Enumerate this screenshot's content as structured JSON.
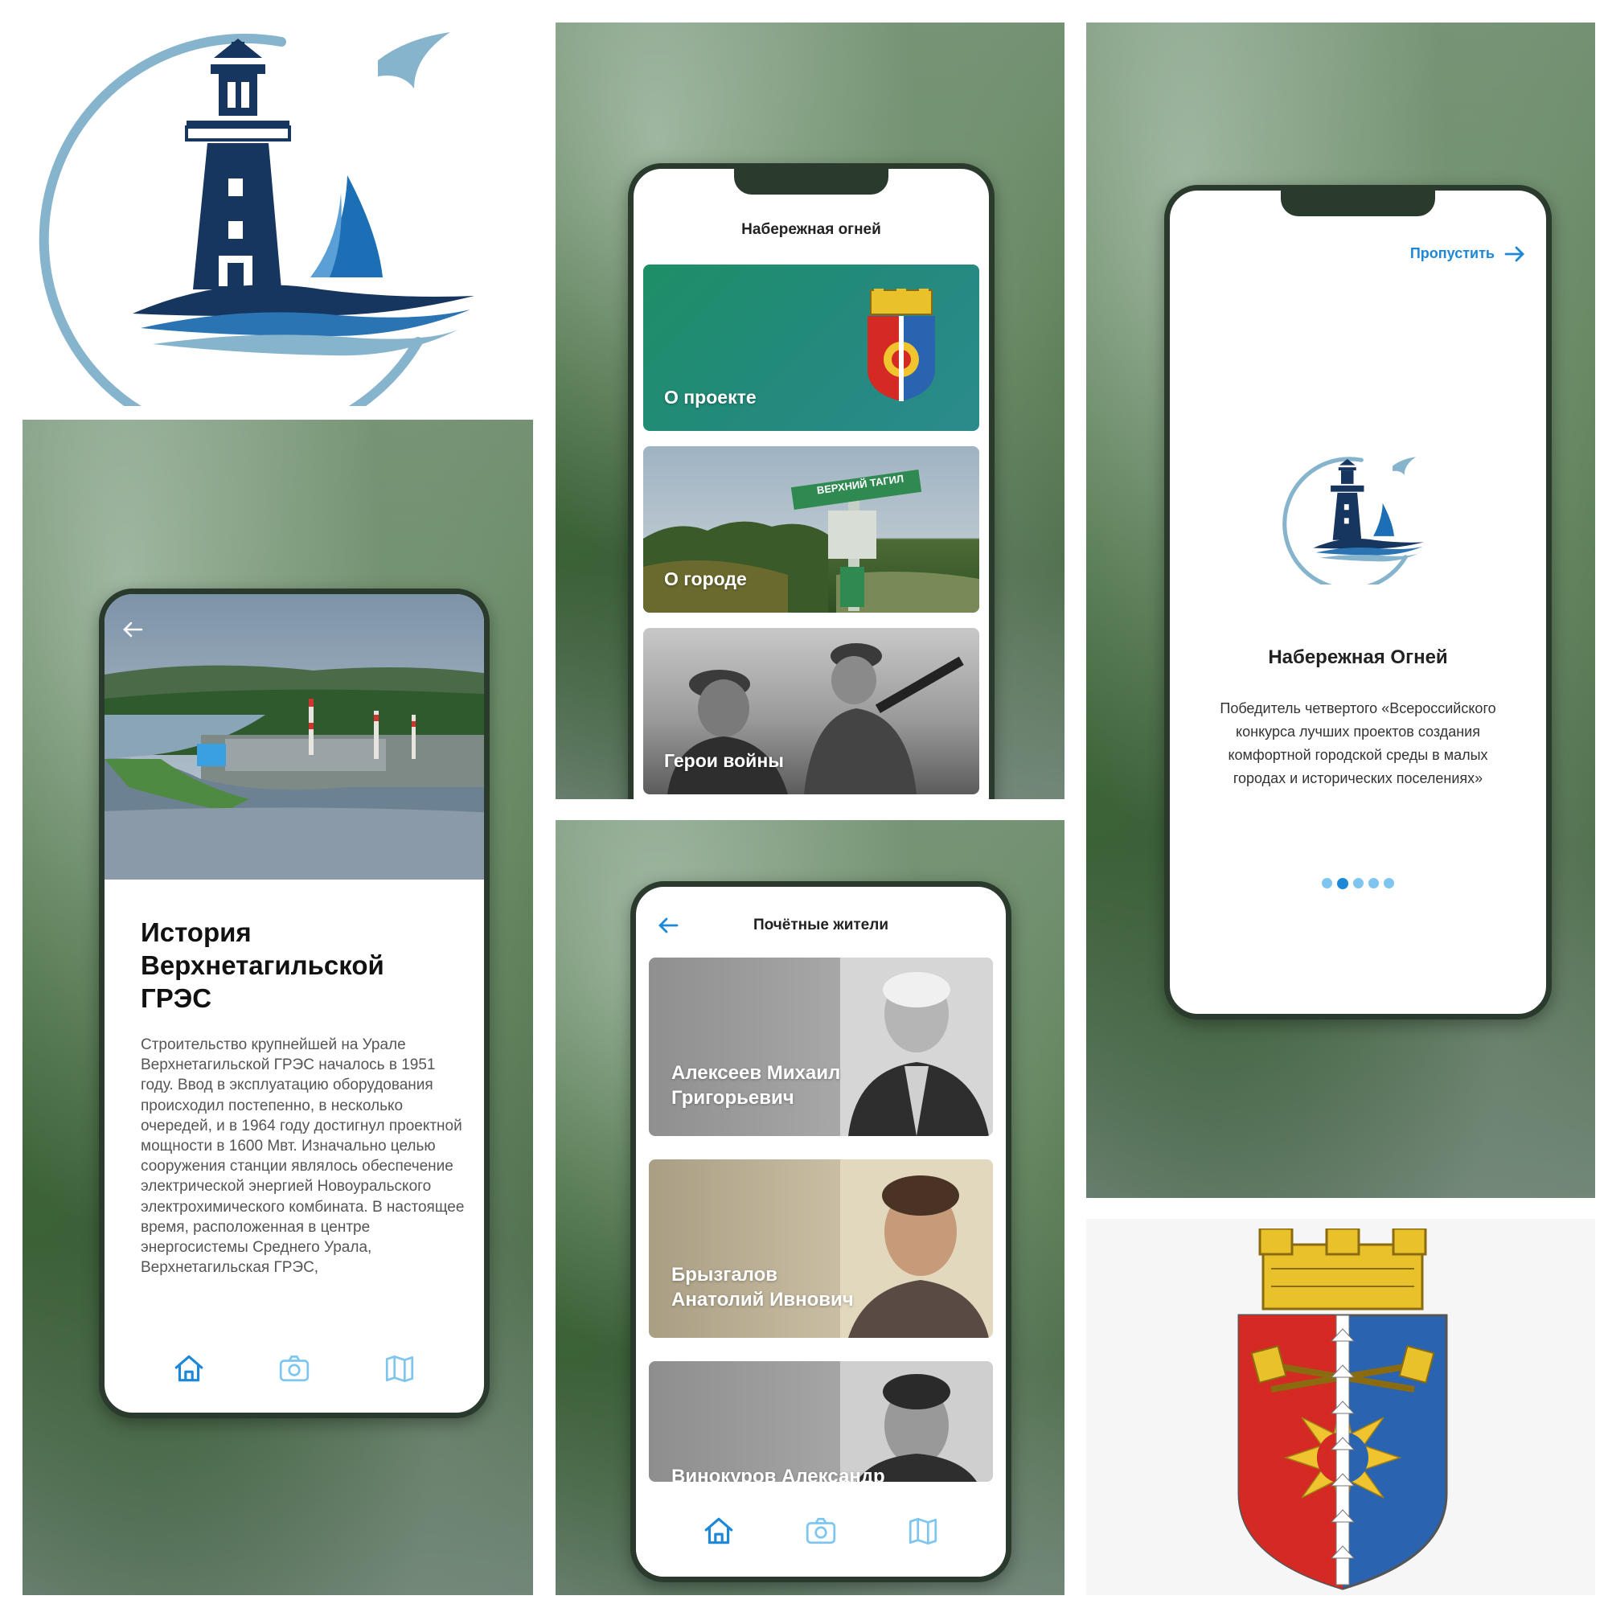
{
  "colors": {
    "accent": "#1e88d8",
    "navy": "#17365f",
    "light_blue": "#7fb2cc",
    "frame": "#2a3a2c"
  },
  "history_screen": {
    "back_icon": "arrow-left-icon",
    "title": "История Верхнетагильской ГРЭС",
    "body": "Строительство крупнейшей на Урале Верхнетагильской ГРЭС началось в 1951 году. Ввод в эксплуатацию оборудования происходил постепенно, в несколько очередей, и в 1964 году достигнул проектной мощности в 1600 Мвт. Изначально целью сооружения станции являлось обеспечение электрической энергией Новоуральского электрохимического комбината. В настоящее время, расположенная в центре энергосистемы Среднего Урала, Верхнетагильская ГРЭС,"
  },
  "menu_screen": {
    "title": "Набережная огней",
    "cards": [
      {
        "label": "О проекте"
      },
      {
        "label": "О городе",
        "sign_text": "ВЕРХНИЙ ТАГИЛ"
      },
      {
        "label": "Герои войны"
      }
    ]
  },
  "onboarding_screen": {
    "skip_label": "Пропустить",
    "skip_icon": "arrow-right-icon",
    "title": "Набережная Огней",
    "text": "Победитель четвертого «Всероссийского конкурса лучших проектов создания комфортной городской среды в малых городах и исторических поселениях»",
    "dots_total": 5,
    "dots_active": 2
  },
  "residents_screen": {
    "title": "Почётные жители",
    "back_icon": "arrow-left-icon",
    "people": [
      {
        "name": "Алексеев Михаил Григорьевич"
      },
      {
        "name": "Брызгалов Анатолий Ивнович"
      },
      {
        "name": "Винокуров Александр"
      }
    ]
  },
  "bottom_nav": {
    "items": [
      {
        "icon": "home-icon",
        "active": true
      },
      {
        "icon": "camera-icon",
        "active": false
      },
      {
        "icon": "map-icon",
        "active": false
      }
    ]
  }
}
